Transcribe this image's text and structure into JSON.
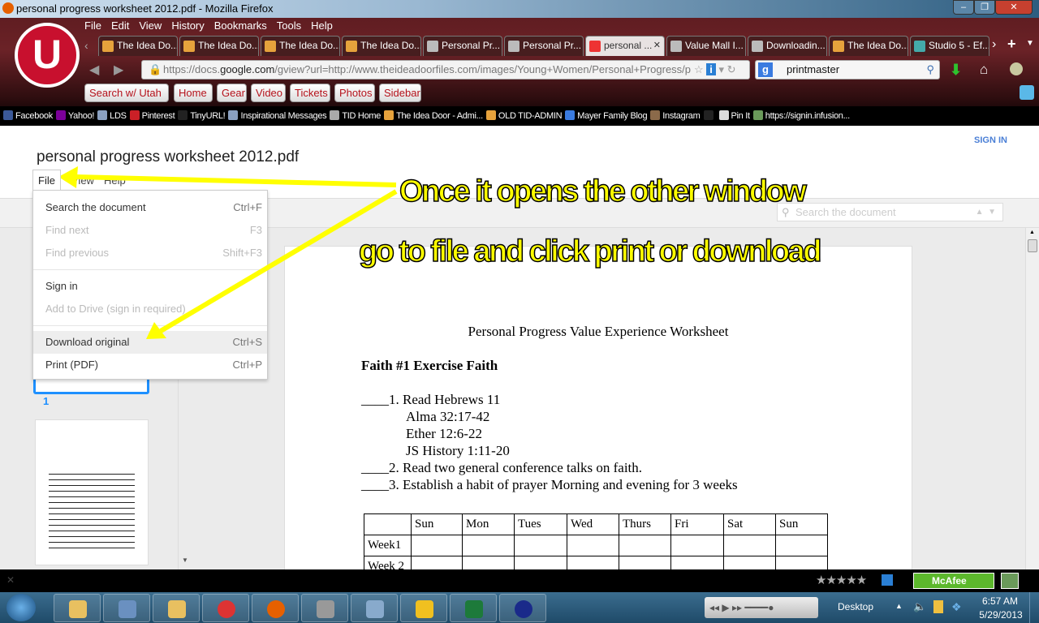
{
  "window": {
    "title": "personal progress worksheet 2012.pdf - Mozilla Firefox",
    "controls": [
      "–",
      "❐",
      "✕"
    ]
  },
  "menubar": [
    "File",
    "Edit",
    "View",
    "History",
    "Bookmarks",
    "Tools",
    "Help"
  ],
  "logo_text": "U",
  "tabs": [
    {
      "label": "The Idea Do...",
      "icon": "joomla-icon"
    },
    {
      "label": "The Idea Do...",
      "icon": "joomla-icon"
    },
    {
      "label": "The Idea Do...",
      "icon": "joomla-icon"
    },
    {
      "label": "The Idea Do...",
      "icon": "joomla-icon"
    },
    {
      "label": "Personal Pr...",
      "icon": "page-icon"
    },
    {
      "label": "Personal Pr...",
      "icon": "page-icon"
    },
    {
      "label": "personal ...",
      "icon": "pdf-icon",
      "active": true
    },
    {
      "label": "Value Mall I...",
      "icon": "page-icon"
    },
    {
      "label": "Downloadin...",
      "icon": "page-icon"
    },
    {
      "label": "The Idea Do...",
      "icon": "joomla-icon"
    },
    {
      "label": "Studio 5 - Ef...",
      "icon": "studio5-icon"
    }
  ],
  "nav": {
    "url_prefix": "https://docs.",
    "url_domain": "google.com",
    "url_rest": "/gview?url=http://www.theideadoorfiles.com/images/Young+Women/Personal+Progress/persor",
    "search_value": "printmaster"
  },
  "custom_buttons": [
    "Search w/ Utah",
    "Home",
    "Gear",
    "Video",
    "Tickets",
    "Photos",
    "Sidebar"
  ],
  "bookmarks": [
    {
      "label": "Facebook",
      "color": "#3b5998"
    },
    {
      "label": "Yahoo!",
      "color": "#7b0099"
    },
    {
      "label": "LDS",
      "color": "#8aa0c0"
    },
    {
      "label": "Pinterest",
      "color": "#cb2027"
    },
    {
      "label": "TinyURL!",
      "color": "#222"
    },
    {
      "label": "Inspirational Messages",
      "color": "#8aa0c0"
    },
    {
      "label": "TID Home",
      "color": "#aaa"
    },
    {
      "label": "The Idea Door - Admi...",
      "color": "#e6a23c"
    },
    {
      "label": "OLD TID-ADMIN",
      "color": "#e6a23c"
    },
    {
      "label": "Mayer Family Blog",
      "color": "#3a7be0"
    },
    {
      "label": "Instagram",
      "color": "#8b6a4a"
    },
    {
      "label": "",
      "color": "#222"
    },
    {
      "label": "Pin It",
      "color": "#ddd"
    },
    {
      "label": "https://signin.infusion...",
      "color": "#6a9a5a"
    }
  ],
  "viewer": {
    "doc_title": "personal progress worksheet 2012.pdf",
    "sign_in": "SIGN IN",
    "menu": [
      "File",
      "View",
      "Help"
    ],
    "search_placeholder": "Search the document",
    "page_number": "1",
    "file_menu": [
      {
        "label": "Search the document",
        "shortcut": "Ctrl+F",
        "enabled": true
      },
      {
        "label": "Find next",
        "shortcut": "F3",
        "enabled": false
      },
      {
        "label": "Find previous",
        "shortcut": "Shift+F3",
        "enabled": false
      },
      {
        "label": "Sign in",
        "shortcut": "",
        "enabled": true
      },
      {
        "label": "Add to Drive (sign in required)",
        "shortcut": "",
        "enabled": false
      },
      {
        "label": "Download original",
        "shortcut": "Ctrl+S",
        "enabled": true,
        "highlighted": true
      },
      {
        "label": "Print (PDF)",
        "shortcut": "Ctrl+P",
        "enabled": true
      }
    ]
  },
  "document": {
    "heading": "Personal Progress Value Experience Worksheet",
    "section": "Faith #1  Exercise Faith",
    "lines": [
      "____1. Read Hebrews 11",
      "Alma 32:17-42",
      "Ether 12:6-22",
      "JS History 1:11-20",
      "____2. Read two general conference talks on faith.",
      "____3. Establish a habit of prayer Morning and evening for 3 weeks"
    ],
    "table_header": [
      "",
      "Sun",
      "Mon",
      "Tues",
      "Wed",
      "Thurs",
      "Fri",
      "Sat",
      "Sun"
    ],
    "table_rows": [
      "Week1",
      "Week 2"
    ]
  },
  "annotation": {
    "line1": "Once it opens the other window",
    "line2": "go to file and click print or download",
    "color": "#ffff00"
  },
  "taskbar": {
    "apps": [
      "outlook",
      "calculator",
      "explorer",
      "chrome",
      "firefox",
      "app",
      "notepad",
      "star-app",
      "excel",
      "app2"
    ],
    "show_desktop": "Desktop",
    "time": "6:57 AM",
    "date": "5/29/2013",
    "mcafee": "McAfee"
  }
}
